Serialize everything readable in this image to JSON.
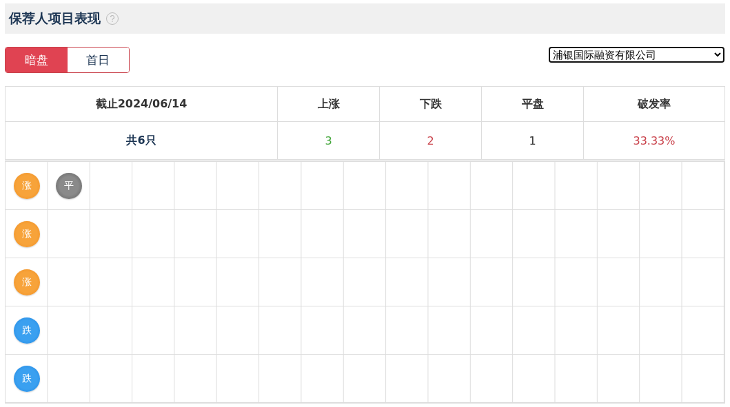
{
  "title": "保荐人项目表现",
  "toggle": [
    {
      "label": "暗盘",
      "selected": true
    },
    {
      "label": "首日",
      "selected": false
    }
  ],
  "sponsor_select": {
    "value": "浦银国际融资有限公司"
  },
  "summary": {
    "columns": [
      "截止2024/06/14",
      "上涨",
      "下跌",
      "平盘",
      "破发率"
    ],
    "values": [
      {
        "text": "共6只",
        "kind": "total"
      },
      {
        "text": "3",
        "kind": "up"
      },
      {
        "text": "2",
        "kind": "down"
      },
      {
        "text": "1",
        "kind": "flat"
      },
      {
        "text": "33.33%",
        "kind": "rate"
      }
    ]
  },
  "grid": {
    "rows": [
      {
        "chips": [
          {
            "label": "涨",
            "kind": "up"
          },
          {
            "label": "平",
            "kind": "flat"
          }
        ]
      },
      {
        "chips": [
          {
            "label": "涨",
            "kind": "up"
          }
        ]
      },
      {
        "chips": [
          {
            "label": "涨",
            "kind": "up"
          }
        ]
      },
      {
        "chips": [
          {
            "label": "跌",
            "kind": "down"
          }
        ]
      },
      {
        "chips": [
          {
            "label": "跌",
            "kind": "down"
          }
        ]
      }
    ]
  }
}
